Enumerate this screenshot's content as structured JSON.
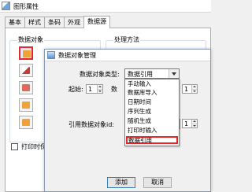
{
  "back_window": {
    "title": "图形属性",
    "tabs": [
      {
        "label": "基本"
      },
      {
        "label": "样式"
      },
      {
        "label": "条码"
      },
      {
        "label": "外观"
      },
      {
        "label": "数据源"
      }
    ],
    "active_tab": "数据源",
    "data_objects_label": "数据对象",
    "processing_label": "处理方法",
    "print_checkbox_label": "打印时保",
    "print_checkbox_checked": false
  },
  "dialog": {
    "title": "数据对象管理",
    "type_label": "数据对象类型:",
    "type_value": "数据引用",
    "start_label": "起始:",
    "start_value": "1",
    "second_spin_value": "1",
    "ref_label": "引用数据对象id:",
    "ref_value": "",
    "ref_spin_value": "1",
    "options": [
      {
        "label": "手动输入"
      },
      {
        "label": "数据库导入"
      },
      {
        "label": "日期时间"
      },
      {
        "label": "序列生成"
      },
      {
        "label": "随机生成"
      },
      {
        "label": "打印时输入"
      },
      {
        "label": "数据引用"
      }
    ],
    "selected_option": "数据引用",
    "add_label": "添加",
    "cancel_label": "取消"
  },
  "colors": {
    "highlight": "#e8242c",
    "titlebar": "#ffffff",
    "window_bg": "#f0f0f0"
  }
}
